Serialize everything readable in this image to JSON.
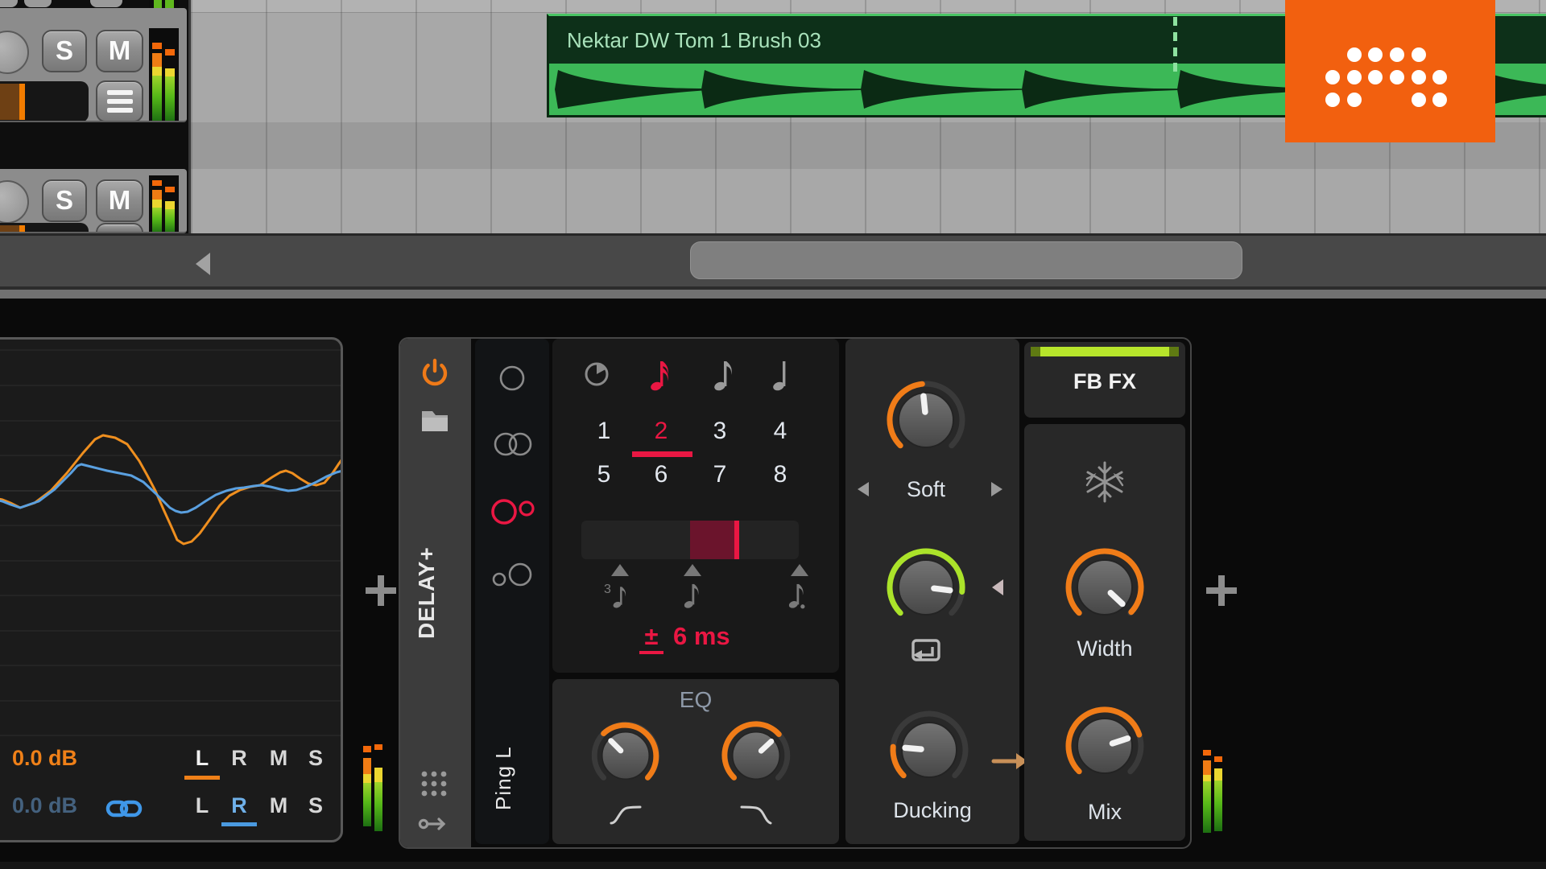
{
  "arranger": {
    "clip": {
      "name": "Nektar DW Tom 1 Brush 03"
    },
    "tracks": [
      {
        "solo_label": "S",
        "mute_label": "M"
      },
      {
        "solo_label": "S",
        "mute_label": "M"
      }
    ]
  },
  "scope": {
    "ch1": {
      "gain": "0.0 dB",
      "channels": [
        "L",
        "R",
        "M",
        "S"
      ],
      "selected": "L",
      "color": "#f08018"
    },
    "ch2": {
      "gain": "0.0 dB",
      "channels": [
        "L",
        "R",
        "M",
        "S"
      ],
      "selected": "R",
      "color": "#5aa0e0"
    }
  },
  "device": {
    "name": "DELAY+",
    "mode": "Ping L",
    "time": {
      "divisions": [
        "1",
        "2",
        "3",
        "4",
        "5",
        "6",
        "7",
        "8"
      ],
      "selected_division": "2",
      "offset_sign": "±",
      "offset_value": "6 ms"
    },
    "eq": {
      "label": "EQ"
    },
    "feedback": {
      "saturation": "Soft"
    },
    "ducking": {
      "label": "Ducking"
    },
    "fb_fx": {
      "label": "FB FX"
    },
    "width": {
      "label": "Width"
    },
    "mix": {
      "label": "Mix"
    }
  },
  "colors": {
    "accent_orange": "#f07c18",
    "accent_red": "#ea1743",
    "accent_lime": "#abe32a",
    "clip_green": "#3cb857",
    "logo_orange": "#f2600f",
    "scope_ch1": "#f08018",
    "scope_ch2": "#5aa0e0"
  },
  "icons": {
    "power-icon": "power symbol",
    "folder-icon": "preset folder",
    "remote-controls-icon": "3x3 dot grid",
    "mapping-icon": "key with arrow",
    "clock-icon": "free-time clock",
    "sixteenth-note-icon": "sixteenth note",
    "eighth-note-icon": "eighth note",
    "quarter-note-icon": "quarter note",
    "triplet-note-icon": "3 + note",
    "dotted-note-icon": "dotted note",
    "freeze-icon": "snowflake",
    "link-icon": "chain links",
    "routing-arrow-icon": "right arrow",
    "feedback-return-icon": "box with return arrow",
    "plus-icon": "+",
    "scroll-left-icon": "left triangle"
  }
}
